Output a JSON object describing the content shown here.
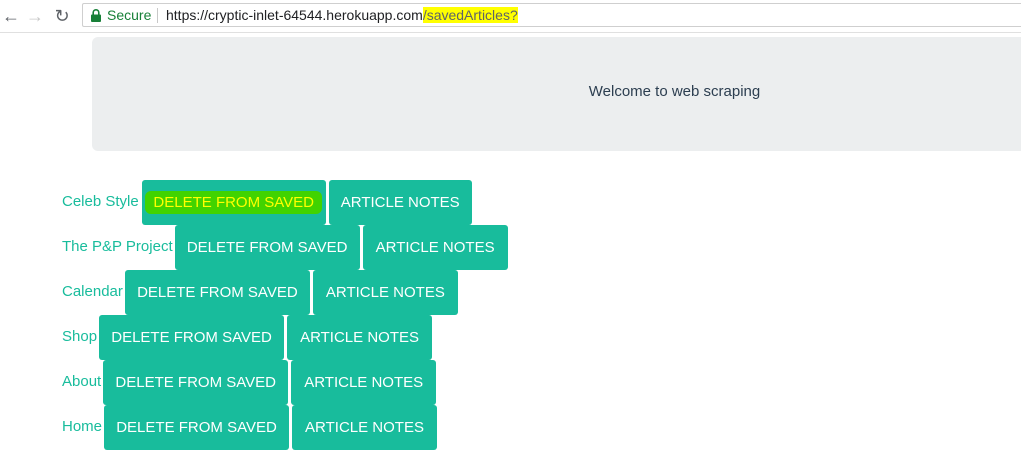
{
  "browser": {
    "secure_label": "Secure",
    "url_base": "https://cryptic-inlet-64544.herokuapp.com",
    "url_path": "/savedArticles?"
  },
  "jumbotron": {
    "welcome_text": "Welcome to web scraping"
  },
  "articles": [
    {
      "title": "Celeb Style",
      "delete_label": "DELETE FROM SAVED",
      "notes_label": "ARTICLE NOTES"
    },
    {
      "title": "The P&P Project",
      "delete_label": "DELETE FROM SAVED",
      "notes_label": "ARTICLE NOTES"
    },
    {
      "title": "Calendar",
      "delete_label": "DELETE FROM SAVED",
      "notes_label": "ARTICLE NOTES"
    },
    {
      "title": "Shop",
      "delete_label": "DELETE FROM SAVED",
      "notes_label": "ARTICLE NOTES"
    },
    {
      "title": "About",
      "delete_label": "DELETE FROM SAVED",
      "notes_label": "ARTICLE NOTES"
    },
    {
      "title": "Home",
      "delete_label": "DELETE FROM SAVED",
      "notes_label": "ARTICLE NOTES"
    }
  ],
  "colors": {
    "brand": "#18bc9c",
    "highlight": "#ffff00",
    "green_highlight": "#41d300"
  }
}
